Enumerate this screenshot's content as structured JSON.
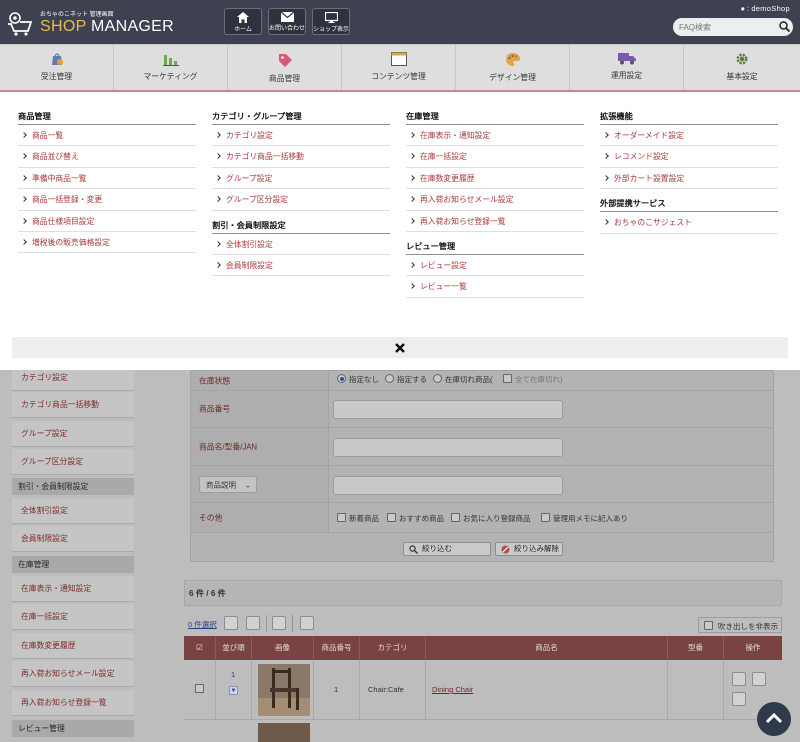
{
  "header": {
    "logo_small": "おちゃのこネット 管理画面",
    "logo_shop": "SHOP",
    "logo_manager": " MANAGER",
    "buttons": [
      {
        "label": "ホーム",
        "icon": "home-icon"
      },
      {
        "label": "お問い合わせ",
        "icon": "mail-icon"
      },
      {
        "label": "ショップ表示",
        "icon": "monitor-icon"
      }
    ],
    "user": "demoShop",
    "search_placeholder": "FAQ検索"
  },
  "nav": [
    {
      "label": "受注管理",
      "icon": "order-icon"
    },
    {
      "label": "マーケティング",
      "icon": "bar-chart-icon"
    },
    {
      "label": "商品管理",
      "icon": "tag-icon"
    },
    {
      "label": "コンテンツ管理",
      "icon": "window-icon"
    },
    {
      "label": "デザイン管理",
      "icon": "palette-icon"
    },
    {
      "label": "運用設定",
      "icon": "truck-icon"
    },
    {
      "label": "基本設定",
      "icon": "gear-icon"
    }
  ],
  "menu": {
    "col1": [
      {
        "title": "商品管理",
        "items": [
          "商品一覧",
          "商品並び替え",
          "準備中商品一覧",
          "商品一括登録・変更",
          "商品仕様項目設定",
          "増税後の販売価格設定"
        ]
      }
    ],
    "col2": [
      {
        "title": "カテゴリ・グループ管理",
        "items": [
          "カテゴリ設定",
          "カテゴリ商品一括移動",
          "グループ設定",
          "グループ区分設定"
        ]
      },
      {
        "title": "割引・会員制限設定",
        "items": [
          "全体割引設定",
          "会員制限設定"
        ]
      }
    ],
    "col3": [
      {
        "title": "在庫管理",
        "items": [
          "在庫表示・通知設定",
          "在庫一括設定",
          "在庫数変更履歴",
          "再入荷お知らせメール設定",
          "再入荷お知らせ登録一覧"
        ]
      },
      {
        "title": "レビュー管理",
        "items": [
          "レビュー設定",
          "レビュー一覧"
        ]
      }
    ],
    "col4": [
      {
        "title": "拡張機能",
        "items": [
          "オーダーメイド設定",
          "レコメンド設定",
          "外部カート設置設定"
        ]
      },
      {
        "title": "外部提携サービス",
        "items": [
          "おちゃのこサジェスト"
        ]
      }
    ]
  },
  "sidebar": {
    "items": [
      "カテゴリ設定",
      "カテゴリ商品一括移動",
      "グループ設定",
      "グループ区分設定"
    ],
    "head1": "割引・会員制限設定",
    "items2": [
      "全体割引設定",
      "会員制限設定"
    ],
    "head2": "在庫管理",
    "items3": [
      "在庫表示・通知設定",
      "在庫一括設定",
      "在庫数変更履歴",
      "再入荷お知らせメール設定",
      "再入荷お知らせ登録一覧"
    ],
    "head3": "レビュー管理"
  },
  "form": {
    "stock_label": "在庫状態",
    "stock_options": [
      "指定なし",
      "指定する",
      "在庫切れ商品(",
      "全て在庫切れ)"
    ],
    "code_label": "商品番号",
    "name_label": "商品名/型番/JAN",
    "desc_select": "商品説明",
    "other_label": "その他",
    "other_options": [
      "新着商品",
      "おすすめ商品",
      "お気に入り登録商品",
      "管理用メモに記入あり"
    ],
    "search_btn": "絞り込む",
    "clear_btn": "絞り込み解除"
  },
  "list": {
    "count": "6 件 / 6 件",
    "selected": "0 件選択",
    "hide_tooltip": "吹き出しを非表示",
    "headers": [
      "並び順",
      "画像",
      "商品番号",
      "カテゴリ",
      "商品名",
      "型番",
      "操作"
    ],
    "row": {
      "order": "1",
      "code": "1",
      "category": "Chair:Cafe",
      "name": "Dining Chair"
    }
  }
}
